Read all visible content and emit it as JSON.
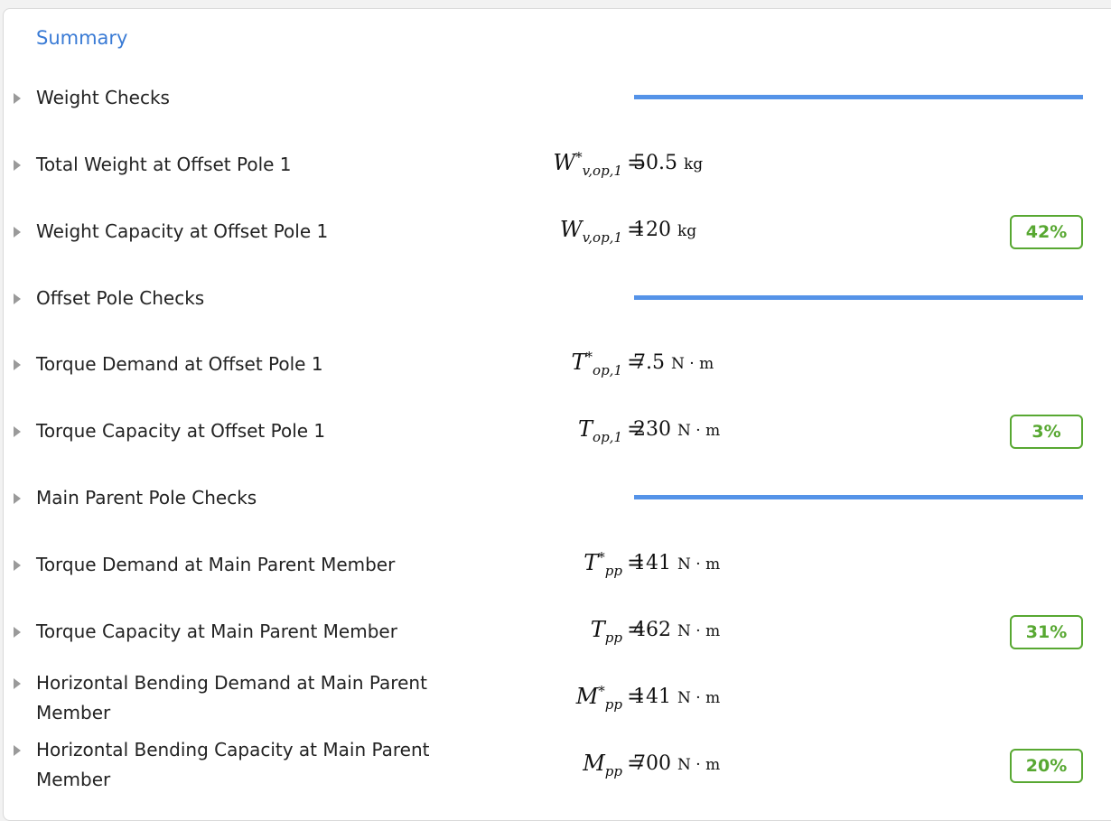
{
  "summary_label": "Summary",
  "rows": [
    {
      "label": "Weight Checks"
    },
    {
      "label": "Total Weight at Offset Pole 1",
      "sym": "W",
      "sup": "*",
      "sub": "v,op,1",
      "eq": "=",
      "value": "50.5",
      "unit": "kg"
    },
    {
      "label": "Weight Capacity at Offset Pole 1",
      "sym": "W",
      "sup": "",
      "sub": "v,op,1",
      "eq": "=",
      "value": "120",
      "unit": "kg",
      "badge": "42%"
    },
    {
      "label": "Offset Pole Checks"
    },
    {
      "label": "Torque Demand at Offset Pole 1",
      "sym": "T",
      "sup": "*",
      "sub": "op,1",
      "eq": "=",
      "value": "7.5",
      "unit": "N · m"
    },
    {
      "label": "Torque Capacity at Offset Pole 1",
      "sym": "T",
      "sup": "",
      "sub": "op,1",
      "eq": "=",
      "value": "230",
      "unit": "N · m",
      "badge": "3%"
    },
    {
      "label": "Main Parent Pole Checks"
    },
    {
      "label": "Torque Demand at Main Parent Member",
      "sym": "T",
      "sup": "*",
      "sub": "pp",
      "eq": "=",
      "value": "141",
      "unit": "N · m"
    },
    {
      "label": "Torque Capacity at Main Parent Member",
      "sym": "T",
      "sup": "",
      "sub": "pp",
      "eq": "=",
      "value": "462",
      "unit": "N · m",
      "badge": "31%"
    },
    {
      "label": "Horizontal Bending Demand at Main Parent Member",
      "sym": "M",
      "sup": "*",
      "sub": "pp",
      "eq": "=",
      "value": "141",
      "unit": "N · m"
    },
    {
      "label": "Horizontal Bending Capacity at Main Parent Member",
      "sym": "M",
      "sup": "",
      "sub": "pp",
      "eq": "=",
      "value": "700",
      "unit": "N · m",
      "badge": "20%"
    }
  ],
  "colors": {
    "link": "#3a7bd5",
    "divider": "#5593e8",
    "badge": "#58a832"
  },
  "icons": {
    "row_expander": "triangle-right-icon"
  }
}
